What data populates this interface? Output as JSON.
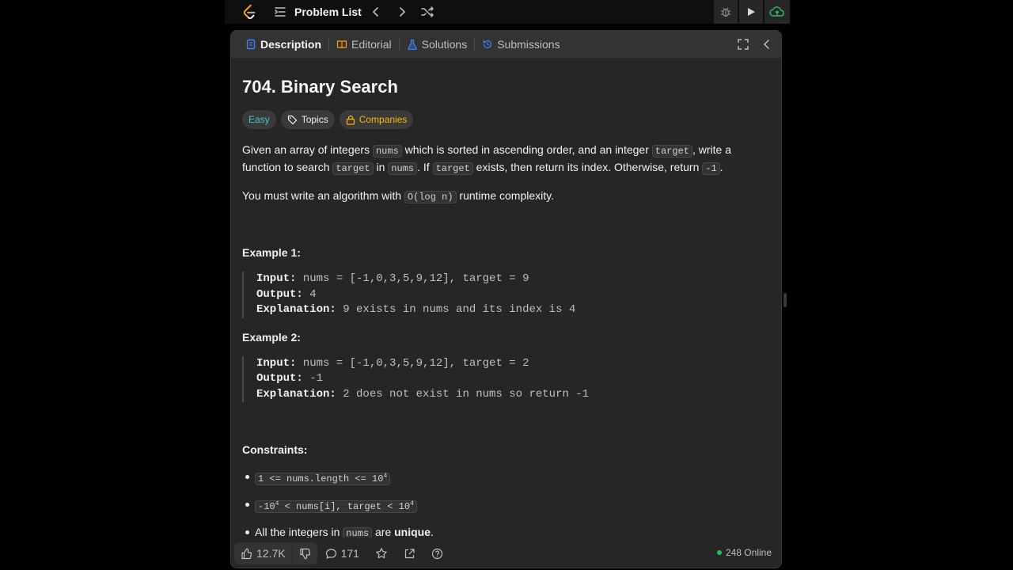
{
  "topbar": {
    "problem_list": "Problem List"
  },
  "tabs": [
    {
      "label": "Description"
    },
    {
      "label": "Editorial"
    },
    {
      "label": "Solutions"
    },
    {
      "label": "Submissions"
    }
  ],
  "problem": {
    "title": "704. Binary Search",
    "difficulty": "Easy",
    "topics": "Topics",
    "companies": "Companies",
    "desc": {
      "t1": "Given an array of integers ",
      "c1": "nums",
      "t2": " which is sorted in ascending order, and an integer ",
      "c2": "target",
      "t3": ", write a function to search ",
      "c3": "target",
      "t4": " in ",
      "c4": "nums",
      "t5": ". If ",
      "c5": "target",
      "t6": " exists, then return its index. Otherwise, return ",
      "c6": "-1",
      "t7": "."
    },
    "complexity": {
      "t1": "You must write an algorithm with ",
      "c1": "O(log n)",
      "t2": " runtime complexity."
    },
    "examples": [
      {
        "title": "Example 1:",
        "input_label": "Input:",
        "input": " nums = [-1,0,3,5,9,12], target = 9",
        "output_label": "Output:",
        "output": " 4",
        "explanation_label": "Explanation:",
        "explanation": " 9 exists in nums and its index is 4"
      },
      {
        "title": "Example 2:",
        "input_label": "Input:",
        "input": " nums = [-1,0,3,5,9,12], target = 2",
        "output_label": "Output:",
        "output": " -1",
        "explanation_label": "Explanation:",
        "explanation": " 2 does not exist in nums so return -1"
      }
    ],
    "constraints_title": "Constraints:",
    "constraints": {
      "c1_pre": "1 <= nums.length <= 10",
      "c1_sup": "4",
      "c2_pre": "-10",
      "c2_sup1": "4",
      "c2_mid": " < nums[i], target < 10",
      "c2_sup2": "4",
      "c3_t1": "All the integers in ",
      "c3_code": "nums",
      "c3_t2": " are ",
      "c3_bold": "unique",
      "c3_t3": "."
    }
  },
  "footer": {
    "likes": "12.7K",
    "comments": "171",
    "online": "248 Online"
  },
  "colors": {
    "easy": "#46c6c2",
    "companies": "#ffb700",
    "online_dot": "#2cbb5d",
    "tab_description_icon": "#3b82f6",
    "submit_icon": "#2cbb5d"
  }
}
